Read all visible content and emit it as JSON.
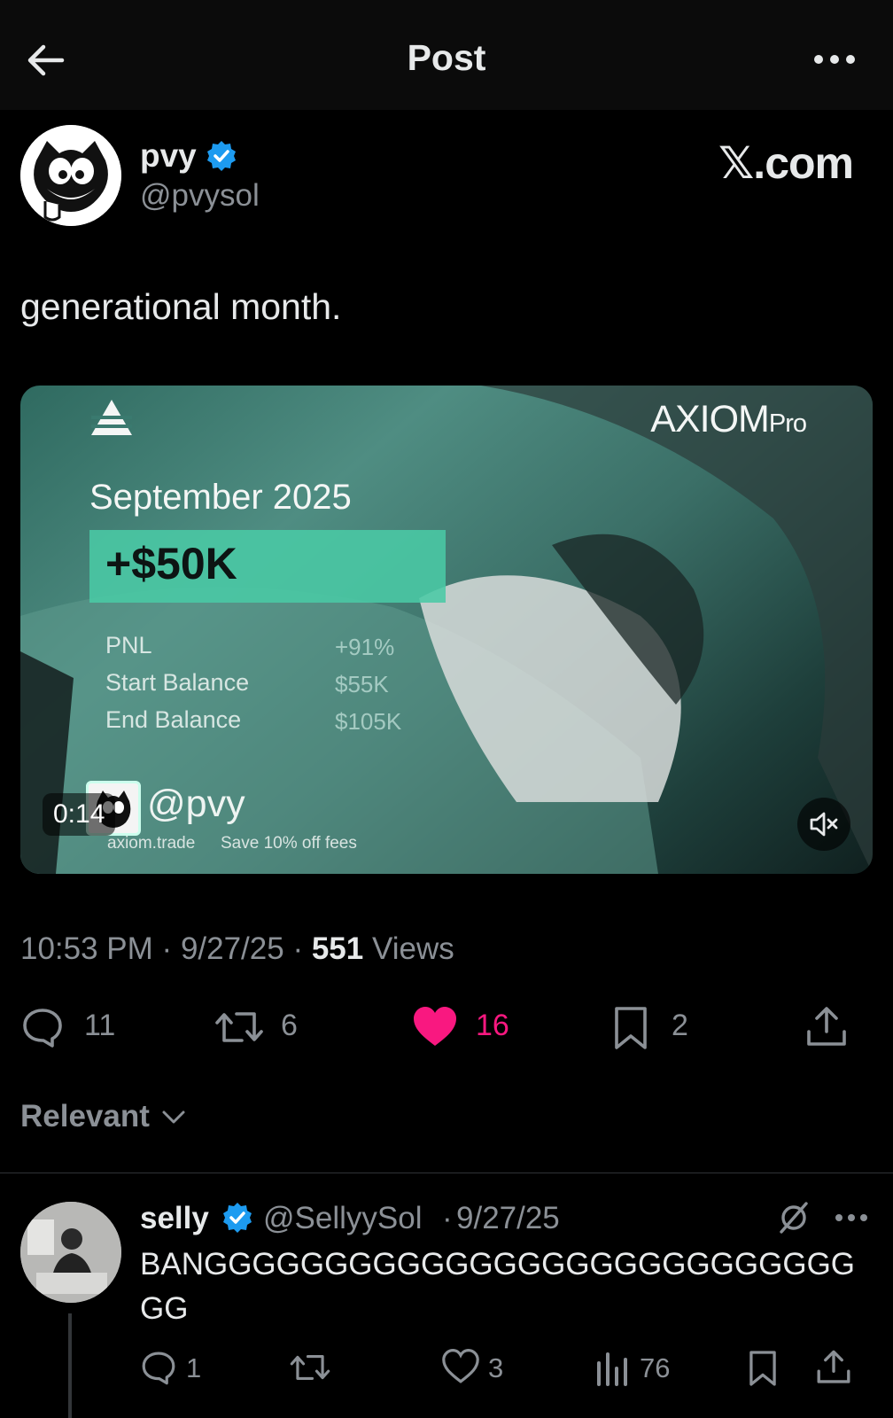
{
  "header": {
    "title": "Post"
  },
  "post": {
    "author_name": "pvy",
    "author_handle": "@pvysol",
    "brand_text": "𝕏.com",
    "text": "generational month.",
    "media": {
      "brand": "AXIOM",
      "brand_suffix": "Pro",
      "month": "September 2025",
      "pnl_amount": "+$50K",
      "stats": [
        {
          "label": "PNL",
          "value": "+91%"
        },
        {
          "label": "Start Balance",
          "value": "$55K"
        },
        {
          "label": "End Balance",
          "value": "$105K"
        }
      ],
      "handle": "@pvy",
      "footer_site": "axiom.trade",
      "footer_promo": "Save 10% off fees",
      "duration": "0:14"
    },
    "time": "10:53 PM",
    "date": "9/27/25",
    "views_count": "551",
    "views_label": "Views",
    "sep": "·",
    "actions": {
      "replies": "11",
      "reposts": "6",
      "likes": "16",
      "bookmarks": "2"
    },
    "colors": {
      "like": "#f91880",
      "verified": "#1d9bf0"
    }
  },
  "replies_sort": {
    "label": "Relevant"
  },
  "reply": {
    "name": "selly",
    "handle": "@SellyySol",
    "sep": "·",
    "date": "9/27/25",
    "text": "BANGGGGGGGGGGGGGGGGGGGGGGGGGGGGG",
    "actions": {
      "replies": "1",
      "likes": "3",
      "views": "76"
    }
  }
}
